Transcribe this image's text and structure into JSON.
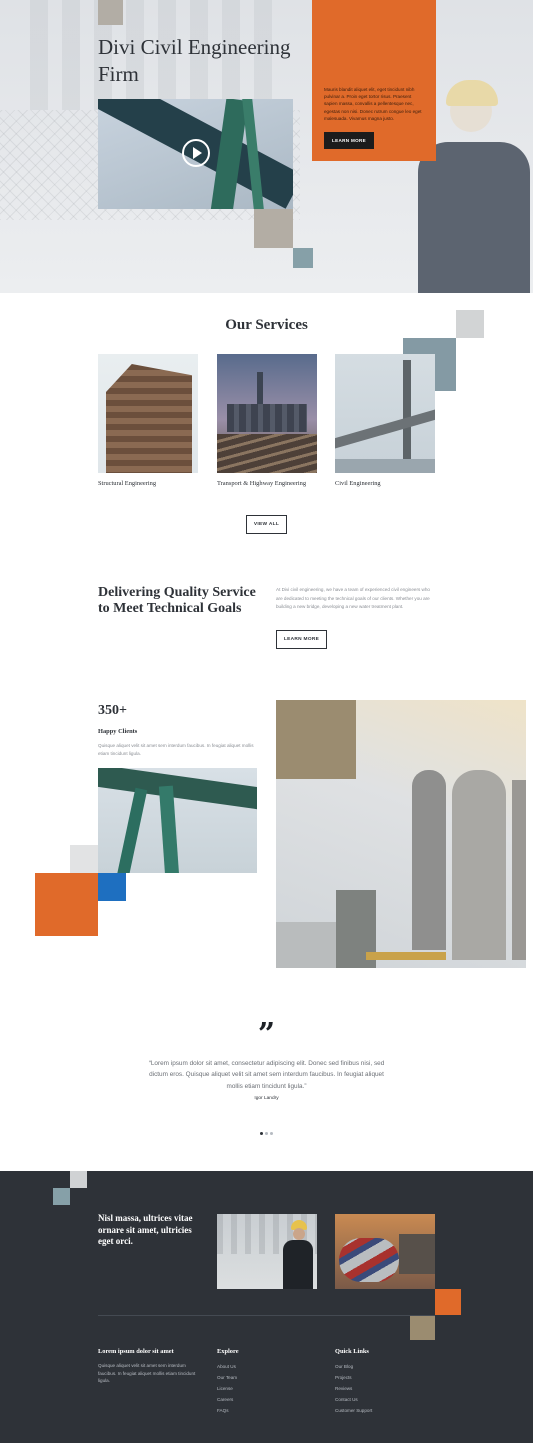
{
  "hero": {
    "title": "Divi Civil Engineering Firm",
    "card_text": "Mauris blandit aliquet elit, eget tincidunt nibh pulvinar a. Proin eget tortor risus. Praesent sapien massa, convallis a pellentesque nec, egestas non nisi. Donec rutrum congue leo eget malesuada. Vivamus magna justo.",
    "cta_label": "LEARN MORE"
  },
  "services": {
    "title": "Our Services",
    "items": [
      {
        "label": "Structural Engineering"
      },
      {
        "label": "Transport & Highway Engineering"
      },
      {
        "label": "Civil Engineering"
      }
    ],
    "view_all_label": "VIEW ALL"
  },
  "quality": {
    "title": "Delivering Quality Service to Meet Technical Goals",
    "body": "At Divi civil engineering, we have a team of experienced civil engineers who are dedicated to meeting the technical goals of our clients. Whether you are building a new bridge, developing a new water treatment plant.",
    "cta_label": "LEARN MORE"
  },
  "stats": {
    "number": "350+",
    "label": "Happy Clients",
    "body": "Quisque aliquet velit sit amet sem interdum faucibus. In feugiat aliquet mollis etiam tincidunt ligula."
  },
  "testimonial": {
    "quote_icon": "quote-icon",
    "text": "“Lorem ipsum dolor sit amet, consectetur adipiscing elit. Donec sed finibus nisi, sed dictum eros. Quisque aliquet velit sit amet sem interdum faucibus. In feugiat aliquet mollis etiam tincidunt ligula.”",
    "author": "Igor Landry",
    "slides": 3,
    "active_slide": 1
  },
  "footer": {
    "tagline": "Nisl massa, ultrices vitae ornare sit amet, ultricies eget orci.",
    "about_heading": "Lorem ipsum dolor sit amet",
    "about_text": "Quisque aliquet velit sit amet sem interdum faucibus. In feugiat aliquet mollis etiam tincidunt ligula.",
    "explore_heading": "Explore",
    "explore_links": [
      "About Us",
      "Our Team",
      "License",
      "Careers",
      "FAQs"
    ],
    "quick_heading": "Quick Links",
    "quick_links": [
      "Our Blog",
      "Projects",
      "Reviews",
      "Contact Us",
      "Customer Support"
    ]
  },
  "colors": {
    "accent_orange": "#e06a2a",
    "dark": "#2e3238",
    "taupe": "#9b8c70",
    "slate_blue": "#849aa4",
    "bright_blue": "#1e6fc0"
  }
}
